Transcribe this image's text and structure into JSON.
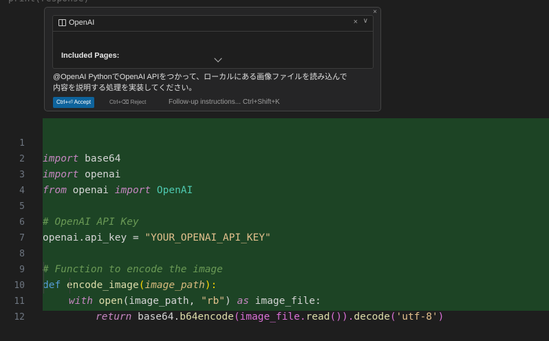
{
  "widget": {
    "close_icon": "×",
    "context": {
      "icon": "book-icon",
      "title": "OpenAI",
      "remove_icon": "×",
      "expand_icon": "∨",
      "included_pages_label": "Included Pages:"
    },
    "prompt_line1": "@OpenAI PythonでOpenAI APIをつかって、ローカルにある画像ファイルを読み込んで",
    "prompt_line2": "内容を説明する処理を実装してください。",
    "accept_label": "Ctrl+⏎ Accept",
    "reject_label": "Ctrl+⌫ Reject",
    "followup_label": "Follow-up instructions... Ctrl+Shift+K"
  },
  "editor": {
    "colors": {
      "added_line_bg": "#1d4425",
      "accept_button": "#0e639c"
    },
    "lines": [
      {
        "n": "1"
      },
      {
        "n": "2"
      },
      {
        "n": "3"
      },
      {
        "n": "4"
      },
      {
        "n": "5"
      },
      {
        "n": "6"
      },
      {
        "n": "7"
      },
      {
        "n": "8"
      },
      {
        "n": "9"
      },
      {
        "n": "10"
      },
      {
        "n": "11"
      },
      {
        "n": "12"
      }
    ],
    "code": {
      "l1_kw": "import",
      "l1_rest": " base64",
      "l2_kw": "import",
      "l2_rest": " openai",
      "l3_kw1": "from",
      "l3_mid": " openai ",
      "l3_kw2": "import",
      "l3_rest": " OpenAI",
      "l5_comment": "# OpenAI API Key",
      "l6_a": "openai.api_key = ",
      "l6_str": "\"YOUR_OPENAI_API_KEY\"",
      "l8_comment": "# Function to encode the image",
      "l9_def": "def",
      "l9_fn": " encode_image",
      "l9_p1": "(",
      "l9_param": "image_path",
      "l9_p2": "):",
      "l10_kw": "with",
      "l10_fn": " open",
      "l10_a": "(image_path, ",
      "l10_str": "\"rb\"",
      "l10_b": ") ",
      "l10_as": "as",
      "l10_c": " image_file:",
      "l11_kw": "return",
      "l11_a": " base64.",
      "l11_fn": "b64encode",
      "l11_b": "(image_file.",
      "l11_fn2": "read",
      "l11_c": "()).",
      "l11_fn3": "decode",
      "l11_d": "(",
      "l11_str": "'utf-8'",
      "l11_e": ")"
    }
  }
}
